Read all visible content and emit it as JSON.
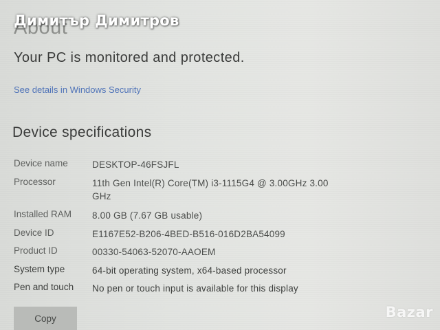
{
  "overlay": {
    "seller_name": "Димитър Димитров",
    "watermark": "Bazar"
  },
  "header": {
    "title": "About"
  },
  "security": {
    "status": "Your PC is monitored and protected.",
    "link_label": "See details in Windows Security"
  },
  "specs": {
    "heading": "Device specifications",
    "rows": [
      {
        "label": "Device name",
        "value": "DESKTOP-46FSJFL"
      },
      {
        "label": "Processor",
        "value": "11th Gen Intel(R) Core(TM) i3-1115G4 @ 3.00GHz   3.00 GHz"
      },
      {
        "label": "Installed RAM",
        "value": "8.00 GB (7.67 GB usable)"
      },
      {
        "label": "Device ID",
        "value": "E1167E52-B206-4BED-B516-016D2BA54099"
      },
      {
        "label": "Product ID",
        "value": "00330-54063-52070-AAOEM"
      },
      {
        "label": "System type",
        "value": "64-bit operating system, x64-based processor"
      },
      {
        "label": "Pen and touch",
        "value": "No pen or touch input is available for this display"
      }
    ],
    "copy_label": "Copy"
  }
}
